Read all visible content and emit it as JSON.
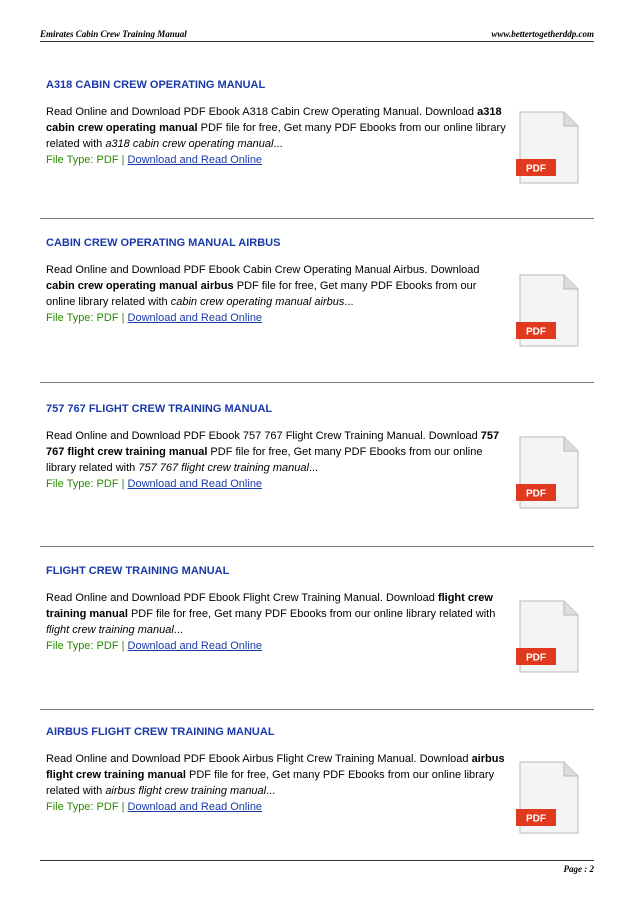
{
  "header": {
    "left": "Emirates Cabin Crew Training Manual",
    "right": "www.bettertogetherddp.com"
  },
  "footer": {
    "page": "Page : 2"
  },
  "icon": {
    "name": "pdf-file-icon",
    "label": "PDF",
    "accent": "#e03a1e"
  },
  "colors": {
    "title": "#1a3aa8",
    "file_type": "#2a8a00",
    "link": "#1a3aa8"
  },
  "entries": [
    {
      "title": "A318 CABIN CREW OPERATING MANUAL",
      "lead": "Read Online and Download PDF Ebook A318 Cabin Crew Operating Manual. Download ",
      "bold": "a318 cabin crew operating manual",
      "mid": " PDF file for free, Get many PDF Ebooks from our online library related with ",
      "italic": "a318 cabin crew operating manual",
      "tail": "...",
      "file_type": "File Type: PDF | ",
      "link": "Download and Read Online"
    },
    {
      "title": "CABIN CREW OPERATING MANUAL AIRBUS",
      "lead": "Read Online and Download PDF Ebook Cabin Crew Operating Manual Airbus. Download ",
      "bold": "cabin crew operating manual airbus",
      "mid": " PDF file for free, Get many PDF Ebooks from our online library related with ",
      "italic": "cabin crew operating manual airbus",
      "tail": "...",
      "file_type": "File Type: PDF | ",
      "link": "Download and Read Online"
    },
    {
      "title": "757 767 FLIGHT CREW TRAINING MANUAL",
      "lead": "Read Online and Download PDF Ebook 757 767 Flight Crew Training Manual. Download ",
      "bold": "757 767 flight crew training manual",
      "mid": " PDF file for free, Get many PDF Ebooks from our online library related with ",
      "italic": "757 767 flight crew training manual",
      "tail": "...",
      "file_type": "File Type: PDF | ",
      "link": "Download and Read Online"
    },
    {
      "title": "FLIGHT CREW TRAINING MANUAL",
      "lead": "Read Online and Download PDF Ebook Flight Crew Training Manual. Download ",
      "bold": "flight crew training manual",
      "mid": " PDF file for free, Get many PDF Ebooks from our online library related with ",
      "italic": "flight crew training manual",
      "tail": "...",
      "file_type": "File Type: PDF | ",
      "link": "Download and Read Online"
    },
    {
      "title": "AIRBUS FLIGHT CREW TRAINING MANUAL",
      "lead": "Read Online and Download PDF Ebook Airbus Flight Crew Training Manual. Download ",
      "bold": "airbus flight crew training manual",
      "mid": " PDF file for free, Get many PDF Ebooks from our online library related with ",
      "italic": "airbus flight crew training manual",
      "tail": "...",
      "file_type": "File Type: PDF | ",
      "link": "Download and Read Online"
    }
  ]
}
